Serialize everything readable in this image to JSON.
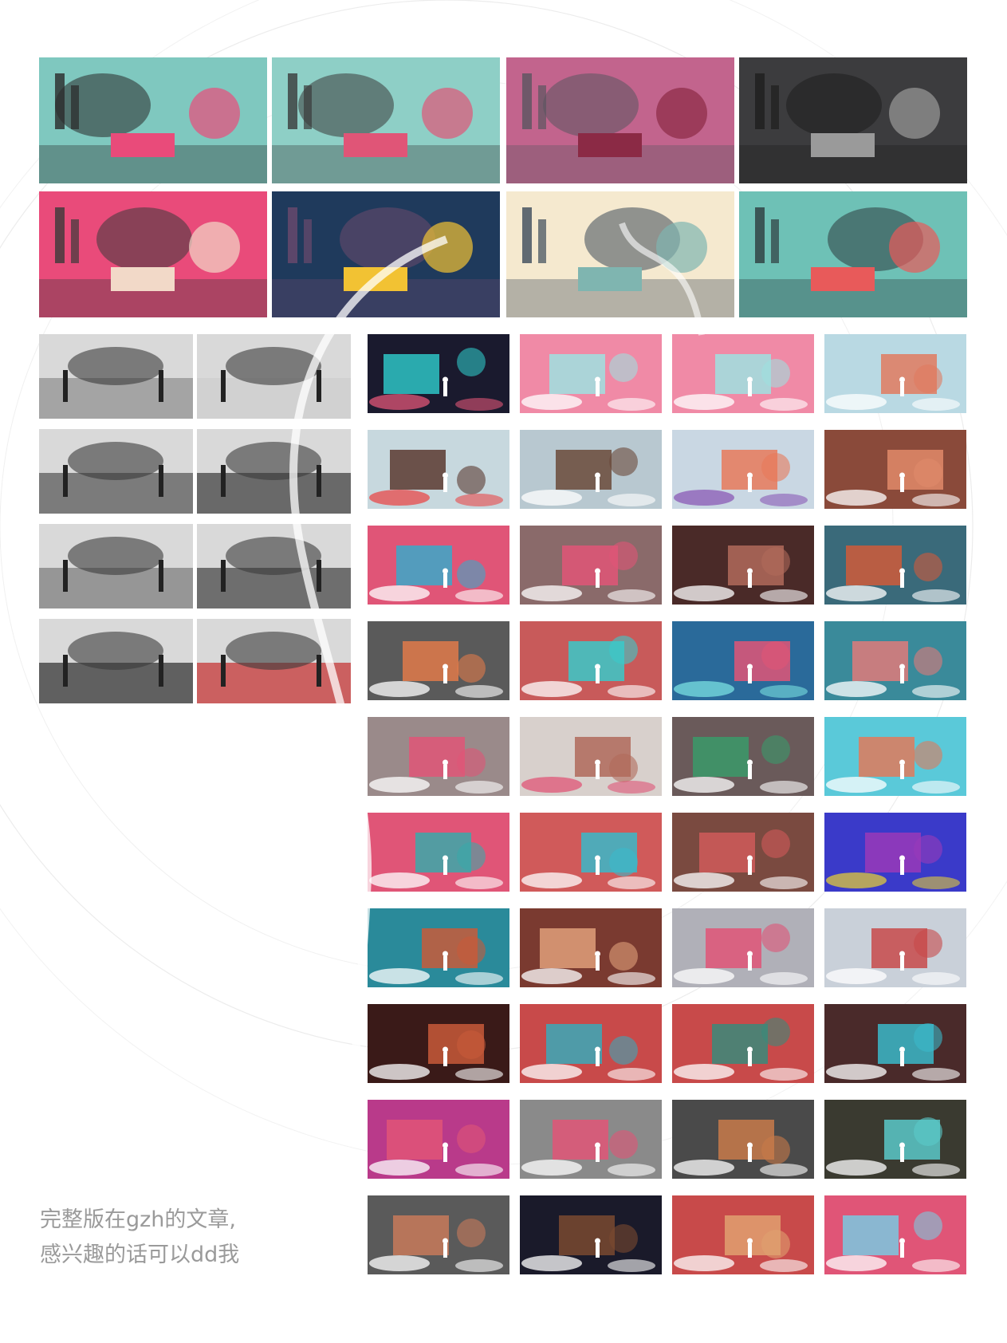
{
  "caption": {
    "line1": "完整版在gzh的文章,",
    "line2": "感兴趣的话可以dd我"
  },
  "large_tiles": [
    {
      "name": "city-ship-collage",
      "bg": "#7fc8bf",
      "accent": "#e94b7a",
      "dark": "#2a2a2a"
    },
    {
      "name": "ship-children-collage",
      "bg": "#8ecfc6",
      "accent": "#e05577",
      "dark": "#3a3a3a"
    },
    {
      "name": "pink-rocks-collage",
      "bg": "#c2648d",
      "accent": "#8b2a45",
      "dark": "#5a5560"
    },
    {
      "name": "dark-cave-collage",
      "bg": "#3c3c3e",
      "accent": "#9a9a9a",
      "dark": "#1e1e1e"
    },
    {
      "name": "gears-collage",
      "bg": "#e94b7a",
      "accent": "#f2d9c8",
      "dark": "#3a3a3a"
    },
    {
      "name": "moon-night-collage",
      "bg": "#1f3a5c",
      "accent": "#f2c233",
      "dark": "#6b4a6e"
    },
    {
      "name": "moon-sea-collage",
      "bg": "#f5e9cf",
      "accent": "#7fb5b0",
      "dark": "#3c4a5a"
    },
    {
      "name": "skyline-sun-collage",
      "bg": "#6ec1b6",
      "accent": "#e85a5a",
      "dark": "#2d3b3e"
    }
  ],
  "bw_photos": [
    {
      "name": "bandstand-photo",
      "tone": "#9a9a9a"
    },
    {
      "name": "playground-frames-photo",
      "tone": "#cfcfcf"
    },
    {
      "name": "model-table-photo",
      "tone": "#6a6a6a"
    },
    {
      "name": "children-digging-photo",
      "tone": "#555555"
    },
    {
      "name": "children-park-photo",
      "tone": "#8a8a8a"
    },
    {
      "name": "junk-playground-photo",
      "tone": "#5a5a5a"
    },
    {
      "name": "climbing-frame-photo",
      "tone": "#4a4a4a"
    },
    {
      "name": "protest-march-photo",
      "tone": "#c84a4a"
    }
  ],
  "render_tiles": [
    {
      "c1": "#1a1a2e",
      "c2": "#2ec4c4",
      "c3": "#e05577"
    },
    {
      "c1": "#f08aa6",
      "c2": "#9fe0e0",
      "c3": "#ffffff"
    },
    {
      "c1": "#f08aa6",
      "c2": "#9fe0e0",
      "c3": "#ffffff"
    },
    {
      "c1": "#b9d9e3",
      "c2": "#e07a5f",
      "c3": "#ffffff"
    },
    {
      "c1": "#c7d8de",
      "c2": "#5a3a30",
      "c3": "#e84a4a"
    },
    {
      "c1": "#b8c8d0",
      "c2": "#6a4a3a",
      "c3": "#ffffff"
    },
    {
      "c1": "#c9d7e3",
      "c2": "#e87a5a",
      "c3": "#8a5ab5"
    },
    {
      "c1": "#8a4a3a",
      "c2": "#e08a6a",
      "c3": "#ffffff"
    },
    {
      "c1": "#e05577",
      "c2": "#3aa9c9",
      "c3": "#ffffff"
    },
    {
      "c1": "#8a6a6a",
      "c2": "#e05577",
      "c3": "#ffffff"
    },
    {
      "c1": "#4a2a28",
      "c2": "#b06a5a",
      "c3": "#ffffff"
    },
    {
      "c1": "#3a6a7a",
      "c2": "#d05a3a",
      "c3": "#ffffff"
    },
    {
      "c1": "#5a5a5a",
      "c2": "#e07a4a",
      "c3": "#ffffff"
    },
    {
      "c1": "#c85a5a",
      "c2": "#3ac9c9",
      "c3": "#ffffff"
    },
    {
      "c1": "#2a6a9a",
      "c2": "#e05577",
      "c3": "#7ae0e0"
    },
    {
      "c1": "#3a8a9a",
      "c2": "#e07a7a",
      "c3": "#ffffff"
    },
    {
      "c1": "#9a8a8a",
      "c2": "#e05577",
      "c3": "#ffffff"
    },
    {
      "c1": "#d8d0cc",
      "c2": "#b06a5a",
      "c3": "#e05577"
    },
    {
      "c1": "#6a5a5a",
      "c2": "#3a9a6a",
      "c3": "#ffffff"
    },
    {
      "c1": "#5ac9d9",
      "c2": "#e07a5a",
      "c3": "#ffffff"
    },
    {
      "c1": "#e05577",
      "c2": "#3aa9a9",
      "c3": "#ffffff"
    },
    {
      "c1": "#d05a5a",
      "c2": "#3ab9c9",
      "c3": "#ffffff"
    },
    {
      "c1": "#7a4a40",
      "c2": "#d05a5a",
      "c3": "#ffffff"
    },
    {
      "c1": "#3a3ac9",
      "c2": "#9a3ab9",
      "c3": "#e0c93a"
    },
    {
      "c1": "#2a8a9a",
      "c2": "#c85a3a",
      "c3": "#ffffff"
    },
    {
      "c1": "#7a3a30",
      "c2": "#e0a07a",
      "c3": "#ffffff"
    },
    {
      "c1": "#b0b0b8",
      "c2": "#e05577",
      "c3": "#ffffff"
    },
    {
      "c1": "#c9d0d9",
      "c2": "#c84a4a",
      "c3": "#ffffff"
    },
    {
      "c1": "#3a1a18",
      "c2": "#c85a3a",
      "c3": "#ffffff"
    },
    {
      "c1": "#c84a4a",
      "c2": "#3aa9b9",
      "c3": "#ffffff"
    },
    {
      "c1": "#c84a4a",
      "c2": "#3a8a7a",
      "c3": "#ffffff"
    },
    {
      "c1": "#4a2a2a",
      "c2": "#3ab9c9",
      "c3": "#ffffff"
    },
    {
      "c1": "#b93a8a",
      "c2": "#e05577",
      "c3": "#ffffff"
    },
    {
      "c1": "#8a8a8a",
      "c2": "#e05577",
      "c3": "#ffffff"
    },
    {
      "c1": "#4a4a4a",
      "c2": "#c87a4a",
      "c3": "#ffffff"
    },
    {
      "c1": "#3a3a30",
      "c2": "#5ac9c9",
      "c3": "#ffffff"
    },
    {
      "c1": "#5a5a5a",
      "c2": "#c87a5a",
      "c3": "#ffffff"
    },
    {
      "c1": "#1a1a2a",
      "c2": "#7a4a30",
      "c3": "#ffffff"
    },
    {
      "c1": "#c84a4a",
      "c2": "#e0a070",
      "c3": "#ffffff"
    },
    {
      "c1": "#e05577",
      "c2": "#7ac9e0",
      "c3": "#ffffff"
    }
  ]
}
